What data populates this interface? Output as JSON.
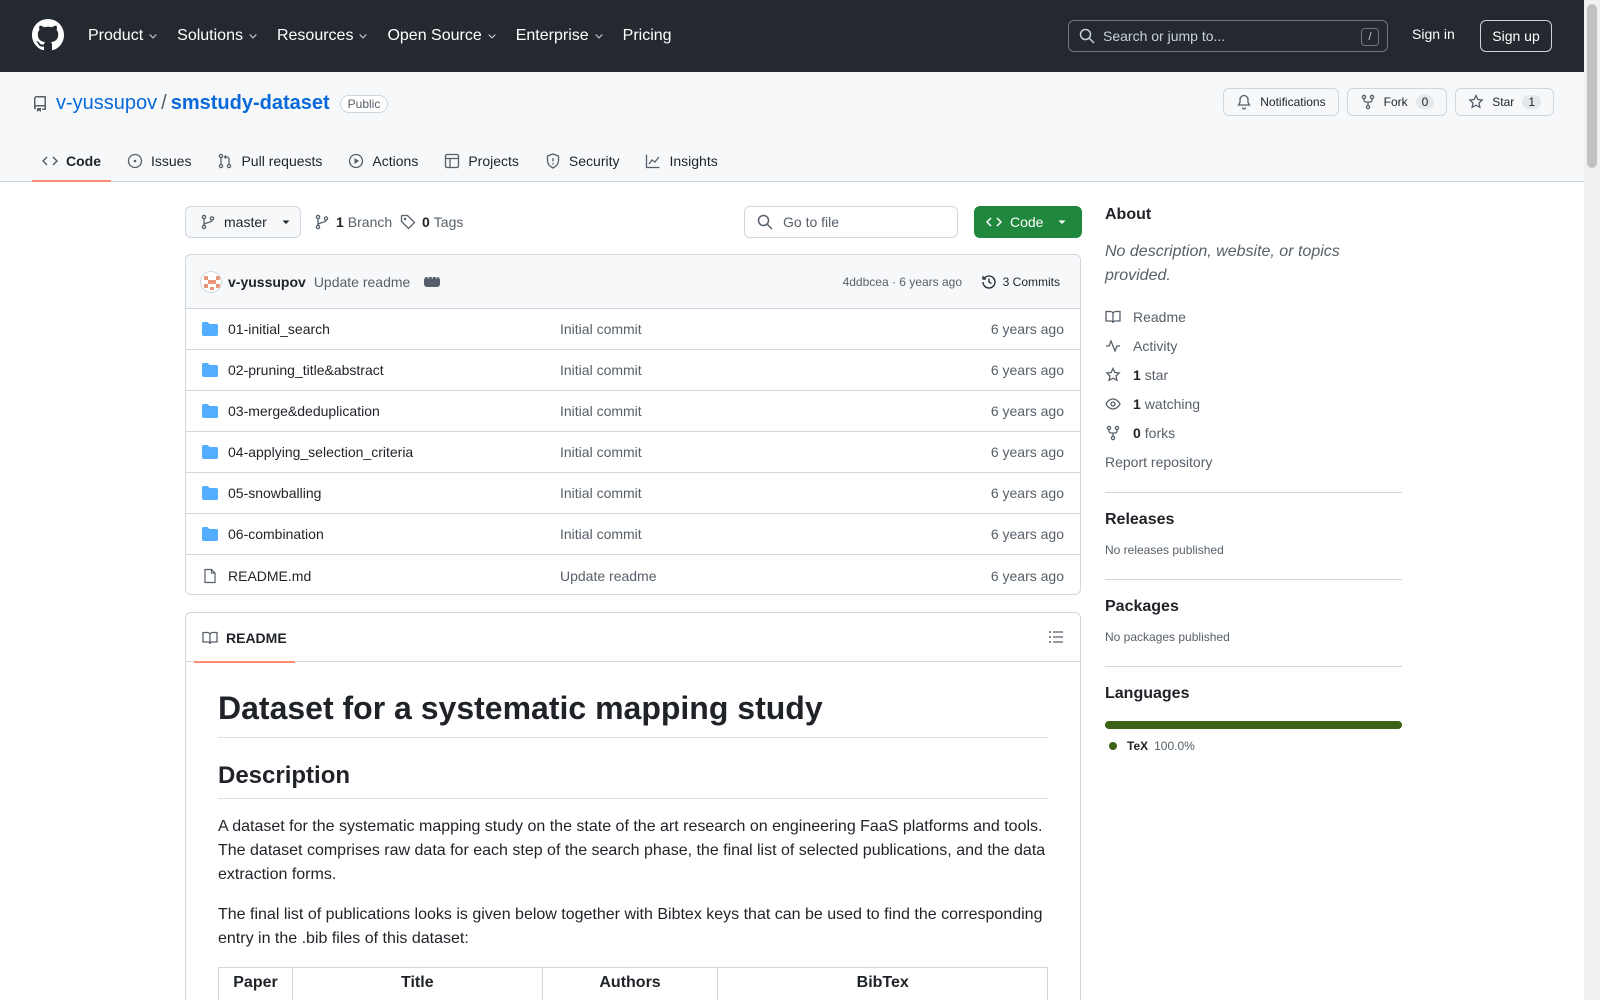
{
  "header": {
    "nav": [
      "Product",
      "Solutions",
      "Resources",
      "Open Source",
      "Enterprise",
      "Pricing"
    ],
    "search_placeholder": "Search or jump to...",
    "search_shortcut": "/",
    "signin": "Sign in",
    "signup": "Sign up"
  },
  "repo": {
    "owner": "v-yussupov",
    "separator": "/",
    "name": "smstudy-dataset",
    "visibility": "Public",
    "notifications_label": "Notifications",
    "fork_label": "Fork",
    "fork_count": "0",
    "star_label": "Star",
    "star_count": "1",
    "tabs": [
      "Code",
      "Issues",
      "Pull requests",
      "Actions",
      "Projects",
      "Security",
      "Insights"
    ]
  },
  "toolbar": {
    "branch": "master",
    "branch_count": "1",
    "branch_label": "Branch",
    "tag_count": "0",
    "tag_label": "Tags",
    "goto_placeholder": "Go to file",
    "code_label": "Code"
  },
  "commit": {
    "author": "v-yussupov",
    "message": "Update readme",
    "meta": "4ddbcea · 6 years ago",
    "count_label": "3 Commits"
  },
  "files": [
    {
      "name": "01-initial_search",
      "type": "dir",
      "message": "Initial commit",
      "date": "6 years ago"
    },
    {
      "name": "02-pruning_title&abstract",
      "type": "dir",
      "message": "Initial commit",
      "date": "6 years ago"
    },
    {
      "name": "03-merge&deduplication",
      "type": "dir",
      "message": "Initial commit",
      "date": "6 years ago"
    },
    {
      "name": "04-applying_selection_criteria",
      "type": "dir",
      "message": "Initial commit",
      "date": "6 years ago"
    },
    {
      "name": "05-snowballing",
      "type": "dir",
      "message": "Initial commit",
      "date": "6 years ago"
    },
    {
      "name": "06-combination",
      "type": "dir",
      "message": "Initial commit",
      "date": "6 years ago"
    },
    {
      "name": "README.md",
      "type": "file",
      "message": "Update readme",
      "date": "6 years ago"
    }
  ],
  "readme": {
    "tab_label": "README",
    "h1": "Dataset for a systematic mapping study",
    "h2": "Description",
    "p1": "A dataset for the systematic mapping study on the state of the art research on engineering FaaS platforms and tools. The dataset comprises raw data for each step of the search phase, the final list of selected publications, and the data extraction forms.",
    "p2": "The final list of publications looks is given below together with Bibtex keys that can be used to find the corresponding entry in the .bib files of this dataset:",
    "table_headers": [
      "Paper",
      "Title",
      "Authors",
      "BibTex"
    ]
  },
  "sidebar": {
    "about_title": "About",
    "about_desc": "No description, website, or topics provided.",
    "readme": "Readme",
    "activity": "Activity",
    "stars_count": "1",
    "stars_label": "star",
    "watching_count": "1",
    "watching_label": "watching",
    "forks_count": "0",
    "forks_label": "forks",
    "report": "Report repository",
    "releases_title": "Releases",
    "releases_desc": "No releases published",
    "packages_title": "Packages",
    "packages_desc": "No packages published",
    "languages_title": "Languages",
    "language_name": "TeX",
    "language_pct": "100.0%"
  },
  "colors": {
    "header_bg": "#24292f",
    "accent": "#0969da",
    "code_button": "#1f883d",
    "tab_underline": "#fd8c73",
    "tex_language": "#3d6117",
    "folder": "#54aeff"
  }
}
